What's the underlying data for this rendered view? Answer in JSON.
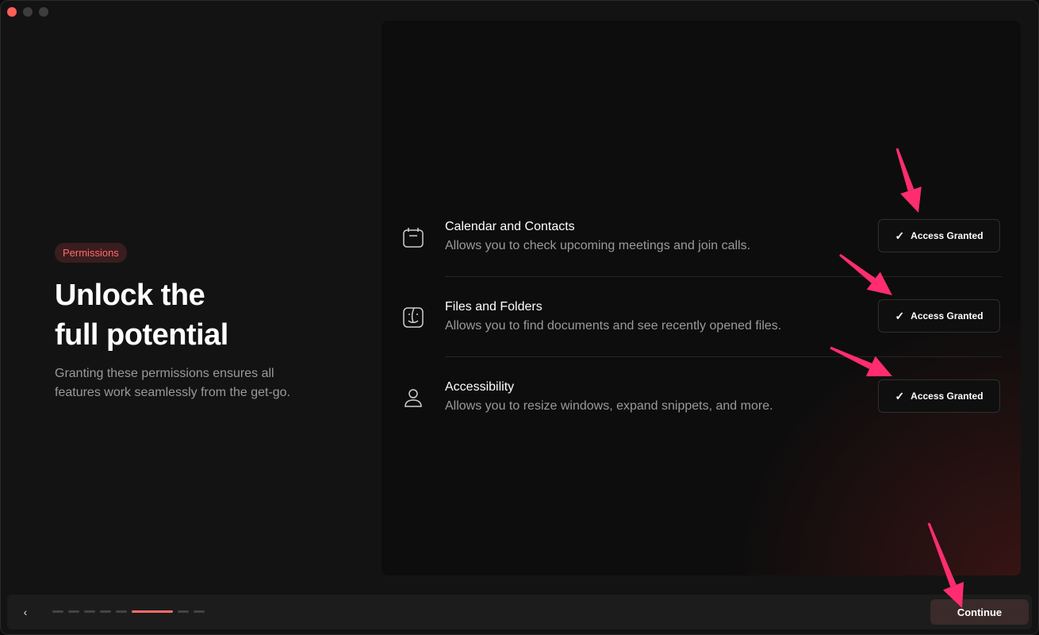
{
  "sidebar": {
    "badge": "Permissions",
    "title_line1": "Unlock the",
    "title_line2": "full potential",
    "subtitle_line1": "Granting these permissions ensures all",
    "subtitle_line2": "features work seamlessly from the get-go."
  },
  "permissions": [
    {
      "title": "Calendar and Contacts",
      "description": "Allows you to check upcoming meetings and join calls.",
      "status": "Access Granted",
      "icon": "calendar-icon"
    },
    {
      "title": "Files and Folders",
      "description": "Allows you to find documents and see recently opened files.",
      "status": "Access Granted",
      "icon": "finder-icon"
    },
    {
      "title": "Accessibility",
      "description": "Allows you to resize windows, expand snippets, and more.",
      "status": "Access Granted",
      "icon": "person-icon"
    }
  ],
  "footer": {
    "back_icon": "‹",
    "continue_label": "Continue",
    "progress": {
      "total_steps": 8,
      "current_step": 6
    }
  },
  "colors": {
    "accent": "#ff6b6b",
    "arrow": "#ff2d6f",
    "close": "#ff5f57"
  },
  "check_glyph": "✓"
}
